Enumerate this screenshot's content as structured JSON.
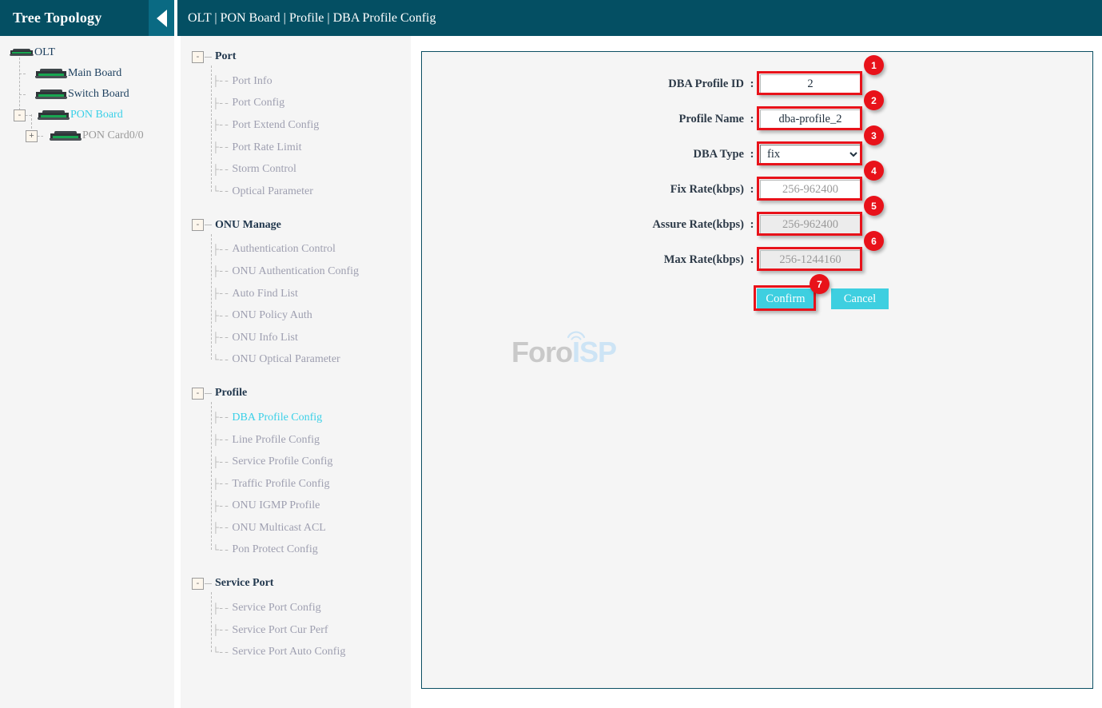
{
  "sidebar": {
    "title": "Tree Topology",
    "collapse_icon": "caret-left-icon",
    "tree": [
      {
        "label": "OLT",
        "icon": "device-icon",
        "color": "dark",
        "toggle": null
      },
      {
        "label": "Main Board",
        "icon": "device-icon",
        "color": "dark",
        "toggle": null
      },
      {
        "label": "Switch Board",
        "icon": "device-icon",
        "color": "dark",
        "toggle": null
      },
      {
        "label": "PON Board",
        "icon": "device-icon",
        "color": "cyan",
        "toggle": "-"
      },
      {
        "label": "PON Card0/0",
        "icon": "device-icon",
        "color": "grey",
        "toggle": "+"
      }
    ]
  },
  "topbar": {
    "breadcrumb": "OLT | PON Board | Profile | DBA Profile Config"
  },
  "nav": {
    "groups": [
      {
        "title": "Port",
        "toggle": "-",
        "items": [
          {
            "label": "Port Info",
            "active": false
          },
          {
            "label": "Port Config",
            "active": false
          },
          {
            "label": "Port Extend Config",
            "active": false
          },
          {
            "label": "Port Rate Limit",
            "active": false
          },
          {
            "label": "Storm Control",
            "active": false
          },
          {
            "label": "Optical Parameter",
            "active": false
          }
        ]
      },
      {
        "title": "ONU Manage",
        "toggle": "-",
        "items": [
          {
            "label": "Authentication Control",
            "active": false
          },
          {
            "label": "ONU Authentication Config",
            "active": false
          },
          {
            "label": "Auto Find List",
            "active": false
          },
          {
            "label": "ONU Policy Auth",
            "active": false
          },
          {
            "label": "ONU Info List",
            "active": false
          },
          {
            "label": "ONU Optical Parameter",
            "active": false
          }
        ]
      },
      {
        "title": "Profile",
        "toggle": "-",
        "items": [
          {
            "label": "DBA Profile Config",
            "active": true
          },
          {
            "label": "Line Profile Config",
            "active": false
          },
          {
            "label": "Service Profile Config",
            "active": false
          },
          {
            "label": "Traffic Profile Config",
            "active": false
          },
          {
            "label": "ONU IGMP Profile",
            "active": false
          },
          {
            "label": "ONU Multicast ACL",
            "active": false
          },
          {
            "label": "Pon Protect Config",
            "active": false
          }
        ]
      },
      {
        "title": "Service Port",
        "toggle": "-",
        "items": [
          {
            "label": "Service Port Config",
            "active": false
          },
          {
            "label": "Service Port Cur Perf",
            "active": false
          },
          {
            "label": "Service Port Auto Config",
            "active": false
          }
        ]
      }
    ]
  },
  "form": {
    "colon": ":",
    "fields": [
      {
        "label": "DBA Profile ID",
        "value": "2",
        "placeholder": "",
        "type": "text",
        "disabled": false,
        "badge": "1"
      },
      {
        "label": "Profile Name",
        "value": "dba-profile_2",
        "placeholder": "",
        "type": "text",
        "disabled": false,
        "badge": "2"
      },
      {
        "label": "DBA Type",
        "value": "fix",
        "options": [
          "fix"
        ],
        "type": "select",
        "disabled": false,
        "badge": "3"
      },
      {
        "label": "Fix Rate(kbps)",
        "value": "",
        "placeholder": "256-962400",
        "type": "text",
        "disabled": false,
        "badge": "4"
      },
      {
        "label": "Assure Rate(kbps)",
        "value": "",
        "placeholder": "256-962400",
        "type": "text",
        "disabled": true,
        "badge": "5"
      },
      {
        "label": "Max Rate(kbps)",
        "value": "",
        "placeholder": "256-1244160",
        "type": "text",
        "disabled": true,
        "badge": "6"
      }
    ],
    "confirm_label": "Confirm",
    "cancel_label": "Cancel",
    "confirm_badge": "7"
  },
  "watermark": {
    "part1": "Foro",
    "part2": "ISP"
  },
  "colors": {
    "header_teal": "#044f63",
    "accent_cyan": "#3ecfe0",
    "annotation_red": "#e8121a",
    "panel_bg": "#f5f5f5"
  }
}
